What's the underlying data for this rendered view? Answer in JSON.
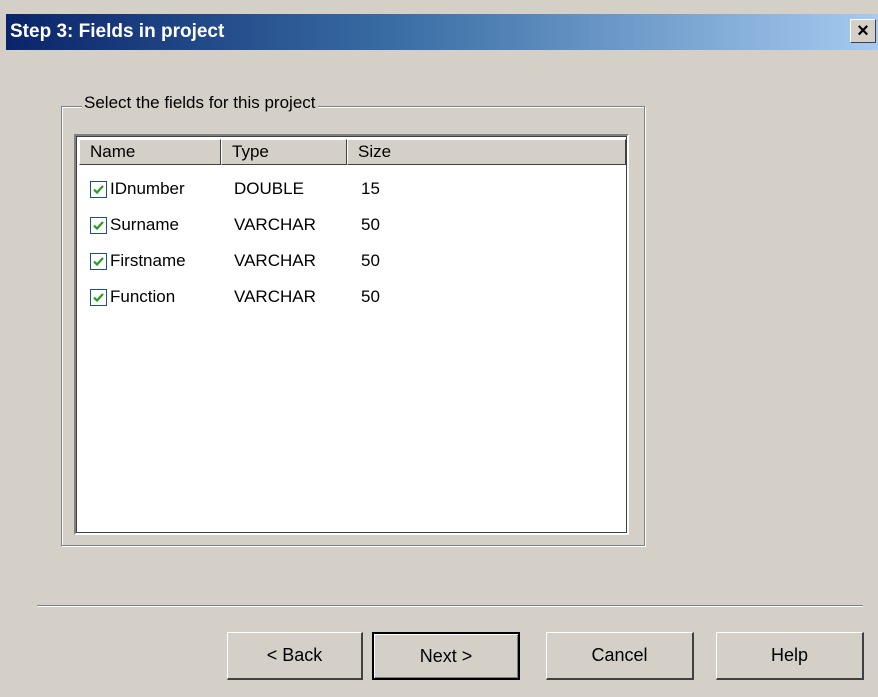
{
  "window": {
    "title": "Step 3: Fields in project",
    "close_glyph": "×"
  },
  "group": {
    "legend": "Select the fields for this project"
  },
  "list": {
    "columns": [
      "Name",
      "Type",
      "Size"
    ],
    "rows": [
      {
        "name": "IDnumber",
        "type": "DOUBLE",
        "size": "15",
        "checked": true
      },
      {
        "name": "Surname",
        "type": "VARCHAR",
        "size": "50",
        "checked": true
      },
      {
        "name": "Firstname",
        "type": "VARCHAR",
        "size": "50",
        "checked": true
      },
      {
        "name": "Function",
        "type": "VARCHAR",
        "size": "50",
        "checked": true
      }
    ]
  },
  "buttons": {
    "back": "< Back",
    "next": "Next >",
    "cancel": "Cancel",
    "help": "Help"
  },
  "colors": {
    "checkmark": "#21a121",
    "title_bar_start": "#0a246a",
    "title_bar_end": "#a6caf0"
  },
  "icons": {
    "checkbox": "check-icon",
    "close": "close-icon"
  }
}
